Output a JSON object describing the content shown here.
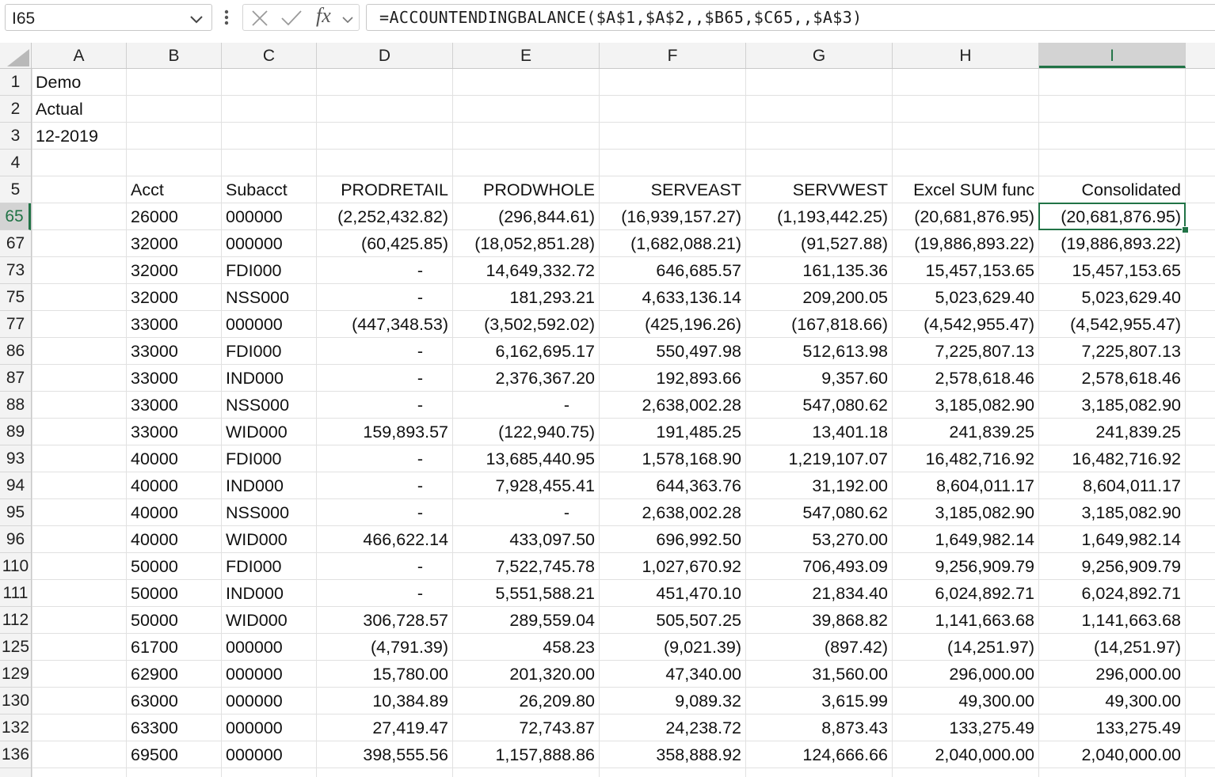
{
  "formula_bar": {
    "name_box": "I65",
    "formula": "=ACCOUNTENDINGBALANCE($A$1,$A$2,,$B65,$C65,,$A$3)",
    "fx_label": "fx"
  },
  "sheet": {
    "columns": [
      "A",
      "B",
      "C",
      "D",
      "E",
      "F",
      "G",
      "H",
      "I"
    ],
    "selected_column": "I",
    "selected_row": "65",
    "rows": [
      {
        "num": "1",
        "cells": [
          "Demo",
          "",
          "",
          "",
          "",
          "",
          "",
          "",
          ""
        ]
      },
      {
        "num": "2",
        "cells": [
          "Actual",
          "",
          "",
          "",
          "",
          "",
          "",
          "",
          ""
        ]
      },
      {
        "num": "3",
        "cells": [
          "12-2019",
          "",
          "",
          "",
          "",
          "",
          "",
          "",
          ""
        ]
      },
      {
        "num": "4",
        "cells": [
          "",
          "",
          "",
          "",
          "",
          "",
          "",
          "",
          ""
        ]
      },
      {
        "num": "5",
        "cells": [
          "",
          "Acct",
          "Subacct",
          "PRODRETAIL",
          "PRODWHOLE",
          "SERVEAST",
          "SERVWEST",
          "Excel SUM func",
          "Consolidated"
        ]
      },
      {
        "num": "65",
        "cells": [
          "",
          "26000",
          "000000",
          "(2,252,432.82)",
          "(296,844.61)",
          "(16,939,157.27)",
          "(1,193,442.25)",
          "(20,681,876.95)",
          "(20,681,876.95)"
        ]
      },
      {
        "num": "67",
        "cells": [
          "",
          "32000",
          "000000",
          "(60,425.85)",
          "(18,052,851.28)",
          "(1,682,088.21)",
          "(91,527.88)",
          "(19,886,893.22)",
          "(19,886,893.22)"
        ]
      },
      {
        "num": "73",
        "cells": [
          "",
          "32000",
          "FDI000",
          "-",
          "14,649,332.72",
          "646,685.57",
          "161,135.36",
          "15,457,153.65",
          "15,457,153.65"
        ]
      },
      {
        "num": "75",
        "cells": [
          "",
          "32000",
          "NSS000",
          "-",
          "181,293.21",
          "4,633,136.14",
          "209,200.05",
          "5,023,629.40",
          "5,023,629.40"
        ]
      },
      {
        "num": "77",
        "cells": [
          "",
          "33000",
          "000000",
          "(447,348.53)",
          "(3,502,592.02)",
          "(425,196.26)",
          "(167,818.66)",
          "(4,542,955.47)",
          "(4,542,955.47)"
        ]
      },
      {
        "num": "86",
        "cells": [
          "",
          "33000",
          "FDI000",
          "-",
          "6,162,695.17",
          "550,497.98",
          "512,613.98",
          "7,225,807.13",
          "7,225,807.13"
        ]
      },
      {
        "num": "87",
        "cells": [
          "",
          "33000",
          "IND000",
          "-",
          "2,376,367.20",
          "192,893.66",
          "9,357.60",
          "2,578,618.46",
          "2,578,618.46"
        ]
      },
      {
        "num": "88",
        "cells": [
          "",
          "33000",
          "NSS000",
          "-",
          "-",
          "2,638,002.28",
          "547,080.62",
          "3,185,082.90",
          "3,185,082.90"
        ]
      },
      {
        "num": "89",
        "cells": [
          "",
          "33000",
          "WID000",
          "159,893.57",
          "(122,940.75)",
          "191,485.25",
          "13,401.18",
          "241,839.25",
          "241,839.25"
        ]
      },
      {
        "num": "93",
        "cells": [
          "",
          "40000",
          "FDI000",
          "-",
          "13,685,440.95",
          "1,578,168.90",
          "1,219,107.07",
          "16,482,716.92",
          "16,482,716.92"
        ]
      },
      {
        "num": "94",
        "cells": [
          "",
          "40000",
          "IND000",
          "-",
          "7,928,455.41",
          "644,363.76",
          "31,192.00",
          "8,604,011.17",
          "8,604,011.17"
        ]
      },
      {
        "num": "95",
        "cells": [
          "",
          "40000",
          "NSS000",
          "-",
          "-",
          "2,638,002.28",
          "547,080.62",
          "3,185,082.90",
          "3,185,082.90"
        ]
      },
      {
        "num": "96",
        "cells": [
          "",
          "40000",
          "WID000",
          "466,622.14",
          "433,097.50",
          "696,992.50",
          "53,270.00",
          "1,649,982.14",
          "1,649,982.14"
        ]
      },
      {
        "num": "110",
        "cells": [
          "",
          "50000",
          "FDI000",
          "-",
          "7,522,745.78",
          "1,027,670.92",
          "706,493.09",
          "9,256,909.79",
          "9,256,909.79"
        ]
      },
      {
        "num": "111",
        "cells": [
          "",
          "50000",
          "IND000",
          "-",
          "5,551,588.21",
          "451,470.10",
          "21,834.40",
          "6,024,892.71",
          "6,024,892.71"
        ]
      },
      {
        "num": "112",
        "cells": [
          "",
          "50000",
          "WID000",
          "306,728.57",
          "289,559.04",
          "505,507.25",
          "39,868.82",
          "1,141,663.68",
          "1,141,663.68"
        ]
      },
      {
        "num": "125",
        "cells": [
          "",
          "61700",
          "000000",
          "(4,791.39)",
          "458.23",
          "(9,021.39)",
          "(897.42)",
          "(14,251.97)",
          "(14,251.97)"
        ]
      },
      {
        "num": "129",
        "cells": [
          "",
          "62900",
          "000000",
          "15,780.00",
          "201,320.00",
          "47,340.00",
          "31,560.00",
          "296,000.00",
          "296,000.00"
        ]
      },
      {
        "num": "130",
        "cells": [
          "",
          "63000",
          "000000",
          "10,384.89",
          "26,209.80",
          "9,089.32",
          "3,615.99",
          "49,300.00",
          "49,300.00"
        ]
      },
      {
        "num": "132",
        "cells": [
          "",
          "63300",
          "000000",
          "27,419.47",
          "72,743.87",
          "24,238.72",
          "8,873.43",
          "133,275.49",
          "133,275.49"
        ]
      },
      {
        "num": "136",
        "cells": [
          "",
          "69500",
          "000000",
          "398,555.56",
          "1,157,888.86",
          "358,888.92",
          "124,666.66",
          "2,040,000.00",
          "2,040,000.00"
        ]
      }
    ]
  },
  "colors": {
    "accent": "#217346",
    "header_bg": "#f3f3f3",
    "gridline": "#e1e1e1"
  }
}
